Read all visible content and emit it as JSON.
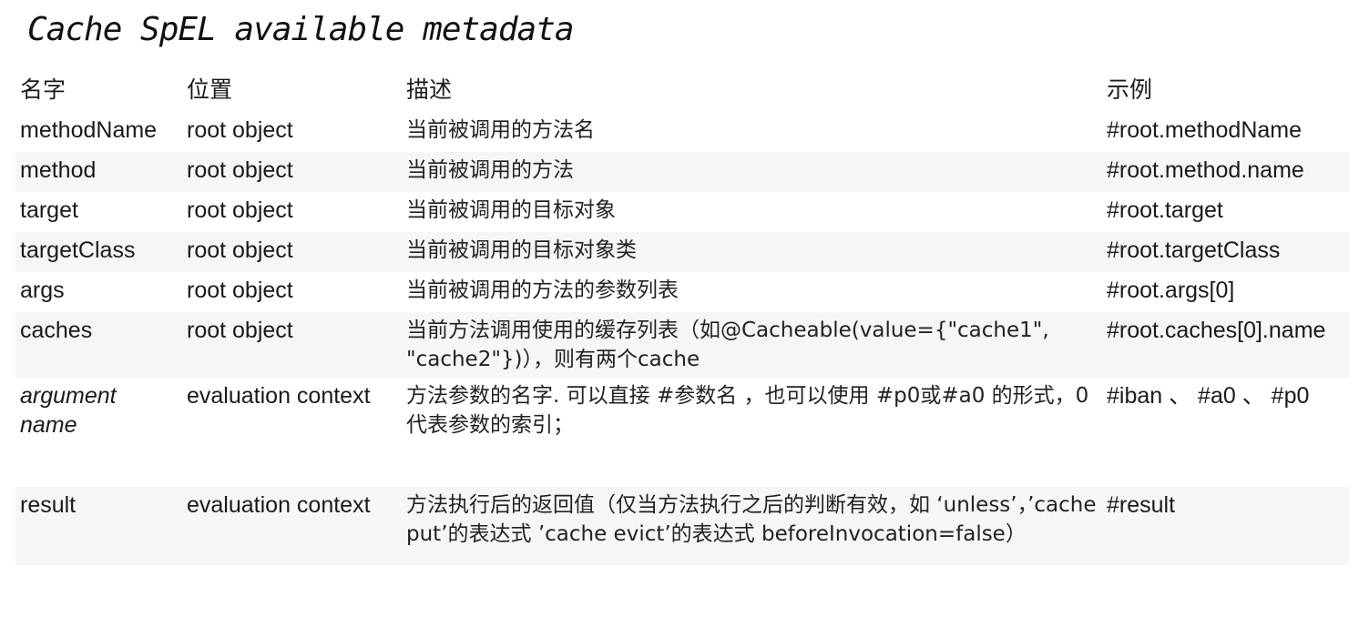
{
  "title": "Cache SpEL available metadata",
  "table": {
    "headers": [
      "名字",
      "位置",
      "描述",
      "示例"
    ],
    "rows": [
      {
        "name": "methodName",
        "location": "root object",
        "description": "当前被调用的方法名",
        "example": "#root.methodName"
      },
      {
        "name": "method",
        "location": "root object",
        "description": "当前被调用的方法",
        "example": "#root.method.name"
      },
      {
        "name": "target",
        "location": "root object",
        "description": "当前被调用的目标对象",
        "example": "#root.target"
      },
      {
        "name": "targetClass",
        "location": "root object",
        "description": "当前被调用的目标对象类",
        "example": "#root.targetClass"
      },
      {
        "name": "args",
        "location": "root object",
        "description": "当前被调用的方法的参数列表",
        "example": "#root.args[0]"
      },
      {
        "name": "caches",
        "location": "root object",
        "description": "当前方法调用使用的缓存列表（如@Cacheable(value={\"cache1\", \"cache2\"})），则有两个cache",
        "example": "#root.caches[0].name"
      },
      {
        "name": "argument name",
        "location": "evaluation context",
        "description": "方法参数的名字. 可以直接 #参数名 ，也可以使用 #p0或#a0 的形式，0代表参数的索引；",
        "example": "#iban 、 #a0 、  #p0"
      },
      {
        "name": "result",
        "location": "evaluation context",
        "description": "方法执行后的返回值（仅当方法执行之后的判断有效，如 ‘unless’，’cache put’的表达式 ’cache evict’的表达式 beforeInvocation=false）",
        "example": "#result"
      }
    ]
  }
}
